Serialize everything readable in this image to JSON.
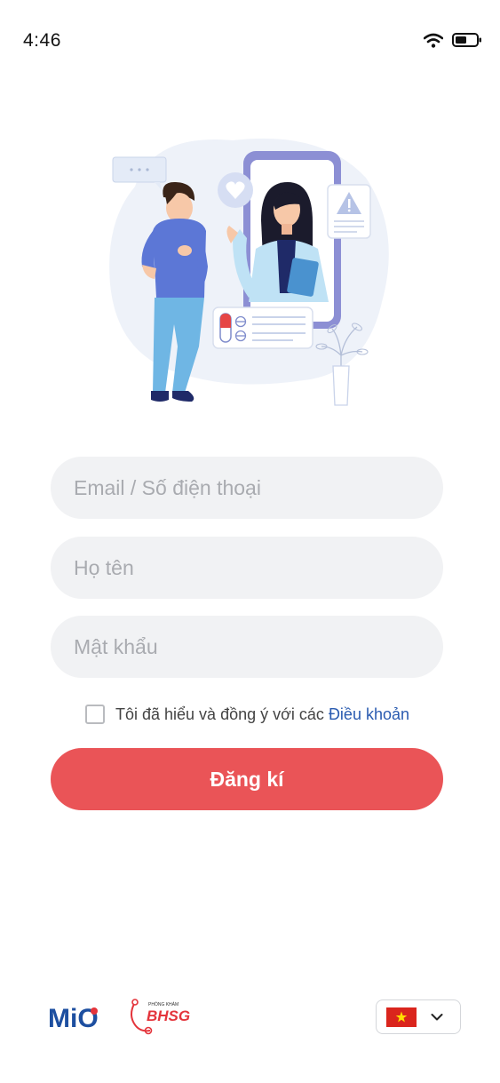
{
  "status_bar": {
    "time": "4:46",
    "icons": [
      "wifi-icon",
      "battery-icon"
    ]
  },
  "illustration": {
    "description_icon": "doctor-patient-illustration-icon"
  },
  "form": {
    "email_placeholder": "Email / Số điện thoại",
    "name_placeholder": "Họ tên",
    "password_placeholder": "Mật khẩu",
    "terms_text": "Tôi đã hiểu và đồng ý với các ",
    "terms_link": "Điều khoản",
    "terms_checked": false,
    "submit_label": "Đăng kí"
  },
  "footer": {
    "logo_mio": "MiO",
    "logo_bhsg_small": "PHÒNG KHÁM",
    "logo_bhsg": "BHSG",
    "language": {
      "selected_flag": "vietnam-flag-icon",
      "dropdown_icon": "chevron-down-icon"
    }
  },
  "colors": {
    "primary_red": "#ea5457",
    "link_blue": "#2a5bb0",
    "field_bg": "#f1f2f4",
    "brand_blue": "#1d4fa0",
    "brand_red": "#e4343b"
  }
}
